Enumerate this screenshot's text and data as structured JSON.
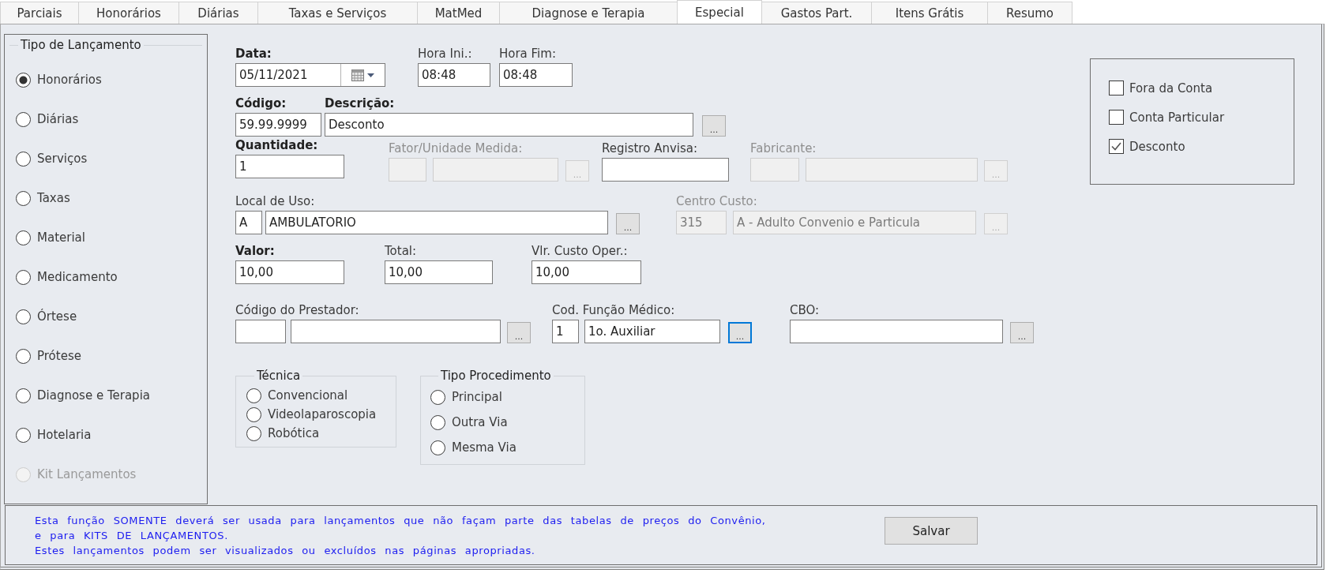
{
  "tabs": [
    {
      "label": "Parciais",
      "selected": false
    },
    {
      "label": "Honorários",
      "selected": false
    },
    {
      "label": "Diárias",
      "selected": false
    },
    {
      "label": "Taxas e Serviços",
      "selected": false
    },
    {
      "label": "MatMed",
      "selected": false
    },
    {
      "label": "Diagnose e Terapia",
      "selected": false
    },
    {
      "label": "Especial",
      "selected": true
    },
    {
      "label": "Gastos Part.",
      "selected": false
    },
    {
      "label": "Itens Grátis",
      "selected": false
    },
    {
      "label": "Resumo",
      "selected": false
    }
  ],
  "launch_type": {
    "title": "Tipo de Lançamento",
    "options": [
      {
        "label": "Honorários",
        "selected": true,
        "disabled": false
      },
      {
        "label": "Diárias",
        "selected": false,
        "disabled": false
      },
      {
        "label": "Serviços",
        "selected": false,
        "disabled": false
      },
      {
        "label": "Taxas",
        "selected": false,
        "disabled": false
      },
      {
        "label": "Material",
        "selected": false,
        "disabled": false
      },
      {
        "label": "Medicamento",
        "selected": false,
        "disabled": false
      },
      {
        "label": "Órtese",
        "selected": false,
        "disabled": false
      },
      {
        "label": "Prótese",
        "selected": false,
        "disabled": false
      },
      {
        "label": "Diagnose e Terapia",
        "selected": false,
        "disabled": false
      },
      {
        "label": "Hotelaria",
        "selected": false,
        "disabled": false
      },
      {
        "label": "Kit Lançamentos",
        "selected": false,
        "disabled": true
      }
    ]
  },
  "form_rows": [
    [
      {
        "kind": "date",
        "label": "Data:",
        "required": true,
        "disabled": false,
        "value": "05/11/2021"
      },
      {
        "kind": "text",
        "label": "Hora Ini.:",
        "required": false,
        "disabled": false,
        "value": "08:48"
      },
      {
        "kind": "text",
        "label": "Hora Fim:",
        "required": false,
        "disabled": false,
        "value": "08:48"
      }
    ],
    [
      {
        "kind": "text",
        "label": "Código:",
        "required": true,
        "disabled": false,
        "value": "59.99.9999"
      },
      {
        "kind": "text",
        "label": "Descrição:",
        "required": true,
        "disabled": false,
        "value": "Desconto",
        "button": {
          "label": "...",
          "focused": false
        }
      }
    ],
    [
      {
        "kind": "text",
        "label": "Quantidade:",
        "required": true,
        "disabled": false,
        "value": "1"
      },
      {
        "kind": "code_text",
        "label": "Fator/Unidade Medida:",
        "required": false,
        "disabled": true,
        "button": {
          "label": "...",
          "focused": false
        }
      },
      {
        "kind": "text",
        "label": "Registro Anvisa:",
        "required": false,
        "disabled": false
      },
      {
        "kind": "code_text",
        "label": "Fabricante:",
        "required": false,
        "disabled": true,
        "button": {
          "label": "...",
          "focused": false
        }
      }
    ],
    [
      {
        "kind": "code_text",
        "label": "Local de Uso:",
        "required": false,
        "disabled": false,
        "code": "A",
        "value": "AMBULATORIO",
        "button": {
          "label": "...",
          "focused": false
        }
      },
      {
        "kind": "code_text",
        "label": "Centro Custo:",
        "required": false,
        "disabled": true,
        "code": "315",
        "value": "A - Adulto Convenio e Particula",
        "button": {
          "label": "...",
          "focused": false
        }
      }
    ],
    [
      {
        "kind": "text",
        "label": "Valor:",
        "required": true,
        "disabled": false,
        "value": "10,00"
      },
      {
        "kind": "text",
        "label": "Total:",
        "required": false,
        "disabled": false,
        "value": "10,00"
      },
      {
        "kind": "text",
        "label": "Vlr. Custo Oper.:",
        "required": false,
        "disabled": false,
        "value": "10,00"
      }
    ],
    [
      {
        "kind": "code_text",
        "label": "Código do Prestador:",
        "required": false,
        "disabled": false,
        "button": {
          "label": "...",
          "focused": false
        }
      },
      {
        "kind": "code_text",
        "label": "Cod. Função Médico:",
        "required": false,
        "disabled": false,
        "code": "1",
        "value": "1o. Auxiliar",
        "button": {
          "label": "...",
          "focused": true
        }
      },
      {
        "kind": "text",
        "label": "CBO:",
        "required": false,
        "disabled": false,
        "button": {
          "label": "...",
          "focused": false
        }
      }
    ]
  ],
  "technique": {
    "title": "Técnica",
    "options": [
      {
        "label": "Convencional",
        "selected": false
      },
      {
        "label": "Videolaparoscopia",
        "selected": false
      },
      {
        "label": "Robótica",
        "selected": false
      }
    ]
  },
  "procedure_type": {
    "title": "Tipo Procedimento",
    "options": [
      {
        "label": "Principal",
        "selected": false
      },
      {
        "label": "Outra Via",
        "selected": false
      },
      {
        "label": "Mesma Via",
        "selected": false
      }
    ]
  },
  "account_flags": [
    {
      "label": "Fora da Conta",
      "checked": false
    },
    {
      "label": "Conta Particular",
      "checked": false
    },
    {
      "label": "Desconto",
      "checked": true
    }
  ],
  "notice_lines": [
    "Esta função SOMENTE deverá ser usada para lançamentos que não façam parte das tabelas de preços do Convênio,",
    "e para KITS DE LANÇAMENTOS.",
    "Estes lançamentos podem ser visualizados ou excluídos nas páginas apropriadas."
  ],
  "save_button": "Salvar"
}
